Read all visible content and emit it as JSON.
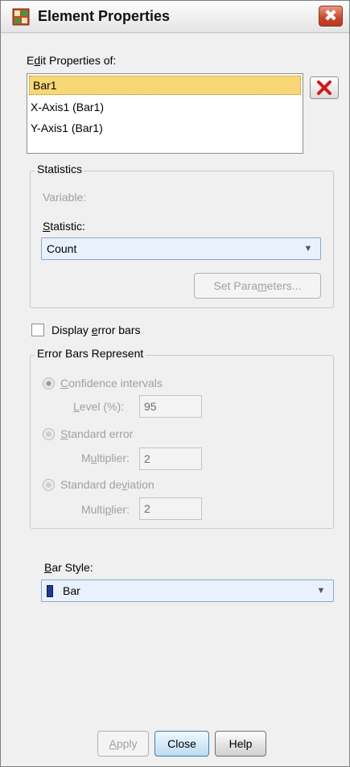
{
  "window": {
    "title": "Element Properties",
    "close_glyph": "✖"
  },
  "edit_properties": {
    "label": "Edit Properties of:",
    "items": [
      "Bar1",
      "X-Axis1 (Bar1)",
      "Y-Axis1 (Bar1)"
    ],
    "selected": "Bar1",
    "delete_icon": "red-x-icon"
  },
  "statistics": {
    "group_title": "Statistics",
    "variable_label": "Variable:",
    "statistic_label": "Statistic:",
    "statistic_value": "Count",
    "set_parameters_label": "Set Parameters..."
  },
  "error_bars": {
    "display_label": "Display error bars",
    "display_checked": false,
    "group_title": "Error Bars Represent",
    "options": [
      {
        "label": "Confidence intervals",
        "field_label": "Level (%):",
        "field_value": "95",
        "selected": true
      },
      {
        "label": "Standard error",
        "field_label": "Multiplier:",
        "field_value": "2",
        "selected": false
      },
      {
        "label": "Standard deviation",
        "field_label": "Multiplier:",
        "field_value": "2",
        "selected": false
      }
    ]
  },
  "bar_style": {
    "label": "Bar Style:",
    "value": "Bar",
    "swatch_color": "#1f3a93"
  },
  "buttons": {
    "apply": "Apply",
    "close": "Close",
    "help": "Help"
  },
  "colors": {
    "selection": "#f8d776",
    "dropdown_bg": "#e9f1fc",
    "close_button": "#c8452b"
  }
}
